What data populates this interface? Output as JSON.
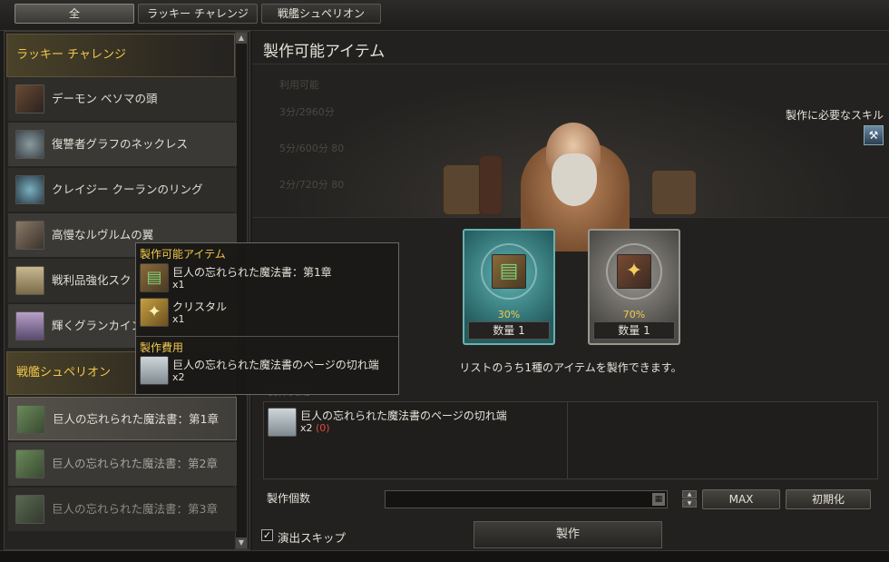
{
  "tabs": [
    {
      "label": "全",
      "active": true
    },
    {
      "label": "ラッキー チャレンジ",
      "active": false
    },
    {
      "label": "戦艦シュペリオン",
      "active": false
    }
  ],
  "list": {
    "category_1": "ラッキー チャレンジ",
    "items_1": [
      {
        "label": "デーモン ベソマの頭",
        "icon": "horn-icon"
      },
      {
        "label": "復讐者グラフのネックレス",
        "icon": "necklace-icon"
      },
      {
        "label": "クレイジー クーランのリング",
        "icon": "ring-icon"
      },
      {
        "label": "高慢なルヴルムの翼",
        "icon": "wing-icon"
      },
      {
        "label": "戦利品強化スク",
        "icon": "scroll-icon"
      },
      {
        "label": "輝くグランカイン",
        "icon": "scroll-icon"
      }
    ],
    "category_2": "戦艦シュペリオン",
    "items_2": [
      {
        "label": "巨人の忘れられた魔法書：第1章",
        "icon": "book-icon"
      },
      {
        "label": "巨人の忘れられた魔法書：第2章",
        "icon": "book-icon"
      },
      {
        "label": "巨人の忘れられた魔法書：第3章",
        "icon": "book-icon"
      }
    ]
  },
  "main": {
    "title": "製作可能アイテム",
    "faded_lines": [
      "利用可能",
      "3分/2960分",
      "5分/600分 80",
      "2分/720分 80"
    ],
    "skill_label": "製作に必要なスキル",
    "skill_icon": "skill-icon",
    "cards": [
      {
        "pct": "30%",
        "qty": "数量 1",
        "icon": "book-icon",
        "color": "#5fb4b4"
      },
      {
        "pct": "70%",
        "qty": "数量 1",
        "icon": "crystal-icon",
        "color": "#9a9792"
      }
    ],
    "info": "リストのうち1種のアイテムを製作できます。",
    "cost_label": "製作費用",
    "cost_item": {
      "name": "巨人の忘れられた魔法書のページの切れ端",
      "qty": "x2",
      "owned": "(0)",
      "icon": "page-icon"
    },
    "count_label": "製作個数",
    "count_value": "",
    "max_label": "MAX",
    "reset_label": "初期化",
    "skip_label": "演出スキップ",
    "skip_checked": "✓",
    "make_label": "製作"
  },
  "tooltip": {
    "header_1": "製作可能アイテム",
    "items": [
      {
        "name": "巨人の忘れられた魔法書：第1章",
        "qty": "x1",
        "icon": "book-icon"
      },
      {
        "name": "クリスタル",
        "qty": "x1",
        "icon": "crystal-icon"
      }
    ],
    "header_2": "製作費用",
    "cost": {
      "name": "巨人の忘れられた魔法書のページの切れ端",
      "qty": "x2",
      "icon": "page-icon"
    }
  },
  "colors": {
    "accent_gold": "#f2c94c",
    "warning_red": "#e04a3a",
    "teal": "#5fb4b4"
  }
}
